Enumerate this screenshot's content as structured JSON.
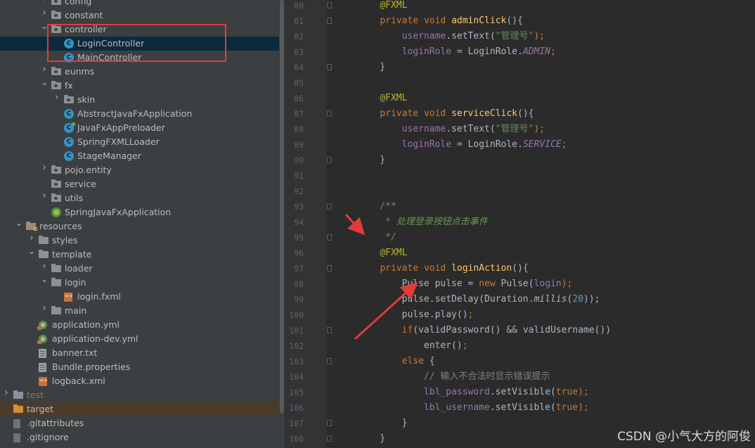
{
  "tree": [
    {
      "indent": 3,
      "arrow": "right",
      "icon": "pkg",
      "label": "config"
    },
    {
      "indent": 3,
      "arrow": "right",
      "icon": "pkg",
      "label": "constant"
    },
    {
      "indent": 3,
      "arrow": "down",
      "icon": "pkg",
      "label": "controller"
    },
    {
      "indent": 4,
      "arrow": "",
      "icon": "cls",
      "label": "LoginController",
      "selected": true
    },
    {
      "indent": 4,
      "arrow": "",
      "icon": "cls",
      "label": "MainController"
    },
    {
      "indent": 3,
      "arrow": "right",
      "icon": "pkg",
      "label": "eunms"
    },
    {
      "indent": 3,
      "arrow": "down",
      "icon": "pkg",
      "label": "fx"
    },
    {
      "indent": 4,
      "arrow": "right",
      "icon": "pkg",
      "label": "skin"
    },
    {
      "indent": 4,
      "arrow": "",
      "icon": "cls",
      "label": "AbstractJavaFxApplication"
    },
    {
      "indent": 4,
      "arrow": "",
      "icon": "cls-run",
      "label": "JavaFxAppPreloader"
    },
    {
      "indent": 4,
      "arrow": "",
      "icon": "cls",
      "label": "SpringFXMLLoader"
    },
    {
      "indent": 4,
      "arrow": "",
      "icon": "cls",
      "label": "StageManager"
    },
    {
      "indent": 3,
      "arrow": "right",
      "icon": "pkg",
      "label": "pojo.entity"
    },
    {
      "indent": 3,
      "arrow": "",
      "icon": "pkg",
      "label": "service"
    },
    {
      "indent": 3,
      "arrow": "right",
      "icon": "pkg",
      "label": "utils"
    },
    {
      "indent": 3,
      "arrow": "",
      "icon": "spring",
      "label": "SpringJavaFxApplication"
    },
    {
      "indent": 1,
      "arrow": "down",
      "icon": "res",
      "label": "resources"
    },
    {
      "indent": 2,
      "arrow": "right",
      "icon": "folder",
      "label": "styles"
    },
    {
      "indent": 2,
      "arrow": "down",
      "icon": "folder",
      "label": "template"
    },
    {
      "indent": 3,
      "arrow": "right",
      "icon": "folder",
      "label": "loader"
    },
    {
      "indent": 3,
      "arrow": "down",
      "icon": "folder",
      "label": "login"
    },
    {
      "indent": 4,
      "arrow": "",
      "icon": "fxml",
      "label": "login.fxml"
    },
    {
      "indent": 3,
      "arrow": "right",
      "icon": "folder",
      "label": "main"
    },
    {
      "indent": 2,
      "arrow": "",
      "icon": "yml",
      "label": "application.yml"
    },
    {
      "indent": 2,
      "arrow": "",
      "icon": "yml",
      "label": "application-dev.yml"
    },
    {
      "indent": 2,
      "arrow": "",
      "icon": "doc",
      "label": "banner.txt"
    },
    {
      "indent": 2,
      "arrow": "",
      "icon": "doc",
      "label": "Bundle.properties"
    },
    {
      "indent": 2,
      "arrow": "",
      "icon": "fxml",
      "label": "logback.xml"
    },
    {
      "indent": 0,
      "arrow": "right",
      "icon": "folder",
      "label": "test",
      "green": true
    },
    {
      "indent": 0,
      "arrow": "",
      "icon": "orange",
      "label": "target",
      "highlight": true
    },
    {
      "indent": 0,
      "arrow": "",
      "icon": "git",
      "label": ".gitattributes"
    },
    {
      "indent": 0,
      "arrow": "",
      "icon": "git",
      "label": ".gitignore"
    }
  ],
  "code_lines": [
    {
      "n": "80",
      "fold": true,
      "tokens": [
        [
          "    ",
          ""
        ],
        [
          "@FXML",
          "an"
        ]
      ]
    },
    {
      "n": "81",
      "fold": true,
      "tokens": [
        [
          "    ",
          ""
        ],
        [
          "private ",
          "kw"
        ],
        [
          "void ",
          "kw"
        ],
        [
          "adminClick",
          "fn"
        ],
        [
          "(){",
          ""
        ]
      ]
    },
    {
      "n": "82",
      "fold": false,
      "tokens": [
        [
          "        ",
          ""
        ],
        [
          "username",
          "fd"
        ],
        [
          ".setText(",
          ""
        ],
        [
          "\"管理号\"",
          "st"
        ],
        [
          ");",
          "kw"
        ]
      ]
    },
    {
      "n": "83",
      "fold": false,
      "tokens": [
        [
          "        ",
          ""
        ],
        [
          "loginRole",
          "fd"
        ],
        [
          " = LoginRole.",
          ""
        ],
        [
          "ADMIN",
          "sf"
        ],
        [
          ";",
          "kw"
        ]
      ]
    },
    {
      "n": "84",
      "fold": true,
      "tokens": [
        [
          "    }",
          ""
        ]
      ]
    },
    {
      "n": "85",
      "fold": false,
      "tokens": []
    },
    {
      "n": "86",
      "fold": false,
      "tokens": [
        [
          "    ",
          ""
        ],
        [
          "@FXML",
          "an"
        ]
      ]
    },
    {
      "n": "87",
      "fold": true,
      "tokens": [
        [
          "    ",
          ""
        ],
        [
          "private ",
          "kw"
        ],
        [
          "void ",
          "kw"
        ],
        [
          "serviceClick",
          "fn"
        ],
        [
          "(){",
          ""
        ]
      ]
    },
    {
      "n": "88",
      "fold": false,
      "tokens": [
        [
          "        ",
          ""
        ],
        [
          "username",
          "fd"
        ],
        [
          ".setText(",
          ""
        ],
        [
          "\"管理号\"",
          "st"
        ],
        [
          ");",
          "kw"
        ]
      ]
    },
    {
      "n": "89",
      "fold": false,
      "tokens": [
        [
          "        ",
          ""
        ],
        [
          "loginRole",
          "fd"
        ],
        [
          " = LoginRole.",
          ""
        ],
        [
          "SERVICE",
          "sf"
        ],
        [
          ";",
          "kw"
        ]
      ]
    },
    {
      "n": "90",
      "fold": true,
      "tokens": [
        [
          "    }",
          ""
        ]
      ]
    },
    {
      "n": "91",
      "fold": false,
      "tokens": []
    },
    {
      "n": "92",
      "fold": false,
      "tokens": []
    },
    {
      "n": "93",
      "fold": true,
      "tokens": [
        [
          "    ",
          ""
        ],
        [
          "/**",
          "cm"
        ]
      ]
    },
    {
      "n": "94",
      "fold": false,
      "tokens": [
        [
          "     ",
          ""
        ],
        [
          "* 处理登录按钮点击事件",
          "cm"
        ]
      ]
    },
    {
      "n": "95",
      "fold": true,
      "tokens": [
        [
          "     ",
          ""
        ],
        [
          "*/",
          "cm"
        ]
      ]
    },
    {
      "n": "96",
      "fold": false,
      "tokens": [
        [
          "    ",
          ""
        ],
        [
          "@FXML",
          "an"
        ]
      ]
    },
    {
      "n": "97",
      "fold": true,
      "tokens": [
        [
          "    ",
          ""
        ],
        [
          "private ",
          "kw"
        ],
        [
          "void ",
          "kw"
        ],
        [
          "loginAction",
          "fn"
        ],
        [
          "(){",
          ""
        ]
      ]
    },
    {
      "n": "98",
      "fold": false,
      "tokens": [
        [
          "        Pulse pulse = ",
          ""
        ],
        [
          "new ",
          "kw"
        ],
        [
          "Pulse(",
          ""
        ],
        [
          "login",
          "fd"
        ],
        [
          ");",
          "kw"
        ]
      ]
    },
    {
      "n": "99",
      "fold": false,
      "tokens": [
        [
          "        pulse.setDelay(Duration.",
          ""
        ],
        [
          "millis",
          "mi"
        ],
        [
          "(",
          ""
        ],
        [
          "20",
          "nm"
        ],
        [
          "));",
          ""
        ]
      ]
    },
    {
      "n": "100",
      "fold": false,
      "tokens": [
        [
          "        pulse.play()",
          ""
        ],
        [
          ";",
          "kw"
        ]
      ]
    },
    {
      "n": "101",
      "fold": true,
      "tokens": [
        [
          "        ",
          ""
        ],
        [
          "if",
          "kw"
        ],
        [
          "(validPassword() && validUsername())",
          ""
        ]
      ]
    },
    {
      "n": "102",
      "fold": false,
      "tokens": [
        [
          "            enter()",
          ""
        ],
        [
          ";",
          "kw"
        ]
      ]
    },
    {
      "n": "103",
      "fold": true,
      "tokens": [
        [
          "        ",
          ""
        ],
        [
          "else ",
          "kw"
        ],
        [
          "{",
          ""
        ]
      ]
    },
    {
      "n": "104",
      "fold": false,
      "tokens": [
        [
          "            ",
          ""
        ],
        [
          "// 输入不合法时显示错误提示",
          "lc"
        ]
      ]
    },
    {
      "n": "105",
      "fold": false,
      "tokens": [
        [
          "            ",
          ""
        ],
        [
          "lbl_password",
          "fd"
        ],
        [
          ".setVisible(",
          ""
        ],
        [
          "true",
          "kw"
        ],
        [
          ");",
          "kw"
        ]
      ]
    },
    {
      "n": "106",
      "fold": false,
      "tokens": [
        [
          "            ",
          ""
        ],
        [
          "lbl_username",
          "fd"
        ],
        [
          ".setVisible(",
          ""
        ],
        [
          "true",
          "kw"
        ],
        [
          ");",
          "kw"
        ]
      ]
    },
    {
      "n": "107",
      "fold": true,
      "tokens": [
        [
          "        }",
          ""
        ]
      ]
    },
    {
      "n": "108",
      "fold": true,
      "tokens": [
        [
          "    }",
          ""
        ]
      ]
    }
  ],
  "watermark": "CSDN @小气大方的阿俊",
  "colors": {
    "annotation_red": "#e03c3c"
  }
}
